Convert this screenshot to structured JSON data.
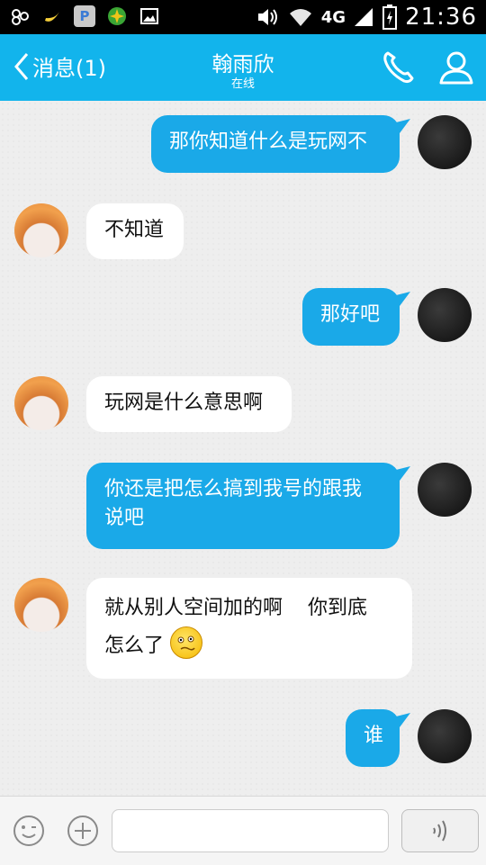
{
  "status_bar": {
    "network": "4G",
    "time": "21:36"
  },
  "header": {
    "back_label": "消息(1)",
    "contact_name": "翰雨欣",
    "contact_status": "在线"
  },
  "messages": [
    {
      "from": "me",
      "text": "那你知道什么是玩网不"
    },
    {
      "from": "her",
      "text": "不知道"
    },
    {
      "from": "me",
      "text": "那好吧"
    },
    {
      "from": "her",
      "text": "玩网是什么意思啊"
    },
    {
      "from": "me",
      "text_line1": "你还是把怎么搞到我号的跟我",
      "text_line2": "说吧"
    },
    {
      "from": "her",
      "text_line1": "就从别人空间加的啊    你到底",
      "text_line2": "怎么了",
      "emoji": "confused-face-icon"
    },
    {
      "from": "me",
      "text": "谁"
    }
  ],
  "colors": {
    "header": "#12b4ec",
    "my_bubble": "#1aa9e8",
    "her_bubble": "#ffffff"
  }
}
